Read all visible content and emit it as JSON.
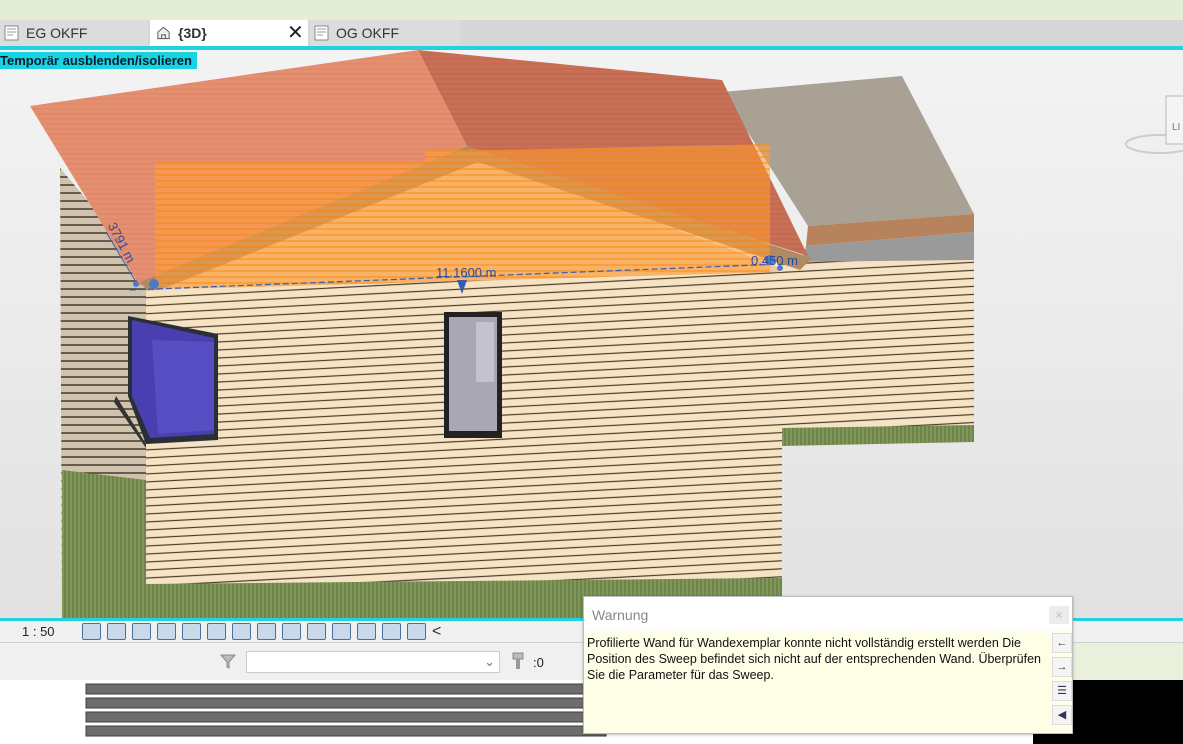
{
  "tabs": [
    {
      "label": "EG OKFF",
      "active": false
    },
    {
      "label": "{3D}",
      "active": true
    },
    {
      "label": "OG OKFF",
      "active": false
    }
  ],
  "viewport": {
    "temp_label": "Temporär ausblenden/isolieren",
    "dimensions": {
      "left": "3791 m",
      "center": "11.1600 m",
      "right": "0.450 m"
    },
    "view_cube_label": "LI"
  },
  "status": {
    "scale": "1 : 50",
    "chevron": "<"
  },
  "selection": {
    "count": ":0"
  },
  "warning": {
    "title": "Warnung",
    "close": "×",
    "message": "Profilierte Wand für Wandexemplar konnte nicht vollständig erstellt werden Die Position des Sweep befindet sich nicht auf der entsprechenden Wand. Überprüfen Sie die Parameter für das Sweep."
  },
  "colors": {
    "accent": "#1fd3df",
    "roof": "#e38a6c",
    "wall": "#f3e0bc",
    "selection": "#ff8c00"
  }
}
